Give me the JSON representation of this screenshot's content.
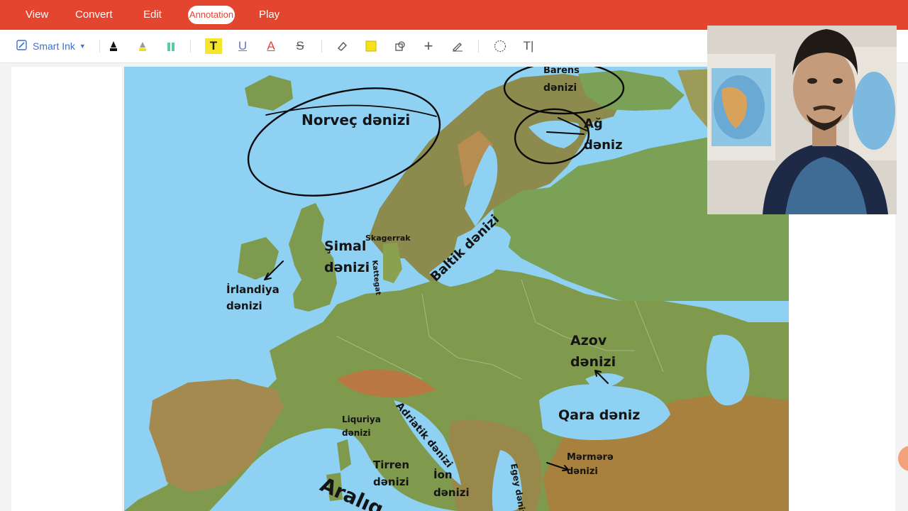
{
  "menu": {
    "items": [
      "View",
      "Convert",
      "Edit",
      "Play"
    ],
    "active": "Annotation"
  },
  "toolbar": {
    "smart_ink_label": "Smart Ink",
    "tools": [
      "pen-icon",
      "highlighter-icon",
      "marker-icon",
      "text-highlight-icon",
      "underline-icon",
      "text-color-icon",
      "strikethrough-icon",
      "eraser-icon",
      "note-icon",
      "shape-icon",
      "plus-icon",
      "signature-icon",
      "lasso-icon",
      "text-box-icon"
    ]
  },
  "map": {
    "labels": {
      "norvec": "Norveç dənizi",
      "barens_line1": "Barens",
      "barens_line2": "dənizi",
      "ag_line1": "Ağ",
      "ag_line2": "dəniz",
      "simal_line1": "Şimal",
      "simal_line2": "dənizi",
      "skagerrak": "Skagerrak",
      "kattegat": "Kattegat",
      "baltik": "Baltik dənizi",
      "irlandiya_line1": "İrlandiya",
      "irlandiya_line2": "dənizi",
      "azov_line1": "Azov",
      "azov_line2": "dənizi",
      "qara": "Qara dəniz",
      "liquriya_line1": "Liquriya",
      "liquriya_line2": "dənizi",
      "adriatik": "Adriatik dənizi",
      "tirren_line1": "Tirren",
      "tirren_line2": "dənizi",
      "ion_line1": "İon",
      "ion_line2": "dənizi",
      "egey": "Egey dənizi",
      "mermere_line1": "Mərmərə",
      "mermere_line2": "dənizi",
      "araliq": "Aralıq"
    }
  },
  "colors": {
    "menubar": "#e3452f",
    "sea": "#8fd1f2",
    "land": "#7f9a4c",
    "accent": "#3a6fd8"
  }
}
